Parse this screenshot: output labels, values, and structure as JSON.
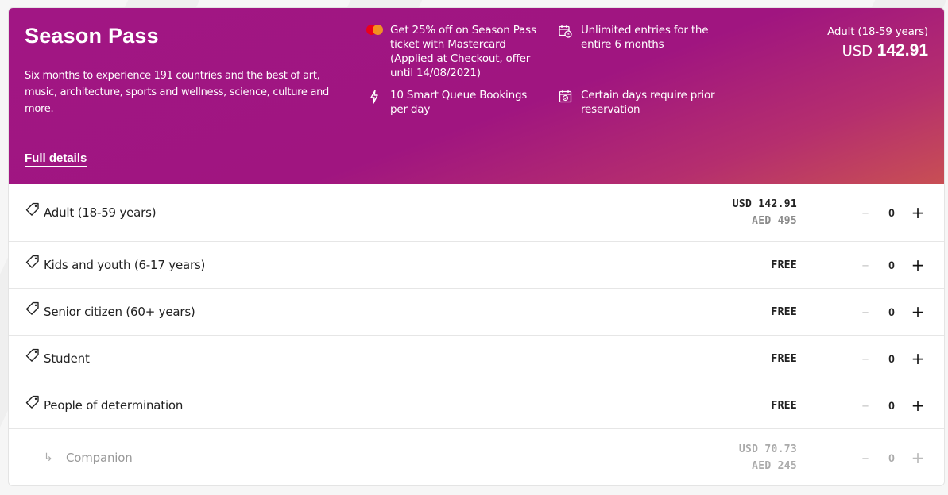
{
  "hero": {
    "title": "Season Pass",
    "description": "Six months to experience 191 countries and the best of art, music, architecture, sports and wellness, science, culture and more.",
    "link": "Full details",
    "features": [
      {
        "icon": "mastercard-icon",
        "text": "Get 25% off on Season Pass ticket with Mastercard (Applied at Checkout, offer until 14/08/2021)"
      },
      {
        "icon": "lightning-icon",
        "text": "10 Smart Queue Bookings per day"
      },
      {
        "icon": "calendar-clock-icon",
        "text": "Unlimited entries for the entire 6 months"
      },
      {
        "icon": "calendar-check-icon",
        "text": "Certain days require prior reservation"
      }
    ],
    "price_category": "Adult (18-59 years)",
    "price_currency": "USD",
    "price_value": "142.91"
  },
  "tickets": [
    {
      "label": "Adult (18-59 years)",
      "price": "USD 142.91",
      "price_sub": "AED 495",
      "qty": "0"
    },
    {
      "label": "Kids and youth (6-17 years)",
      "price": "FREE",
      "price_sub": "",
      "qty": "0"
    },
    {
      "label": "Senior citizen (60+ years)",
      "price": "FREE",
      "price_sub": "",
      "qty": "0"
    },
    {
      "label": "Student",
      "price": "FREE",
      "price_sub": "",
      "qty": "0"
    },
    {
      "label": "People of determination",
      "price": "FREE",
      "price_sub": "",
      "qty": "0"
    },
    {
      "label": "Companion",
      "price": "USD 70.73",
      "price_sub": "AED 245",
      "qty": "0"
    }
  ],
  "controls": {
    "minus": "–",
    "plus": "+",
    "sub_arrow": "↳"
  },
  "colors": {
    "brand": "#a11684",
    "accent_end": "#c84f54"
  }
}
